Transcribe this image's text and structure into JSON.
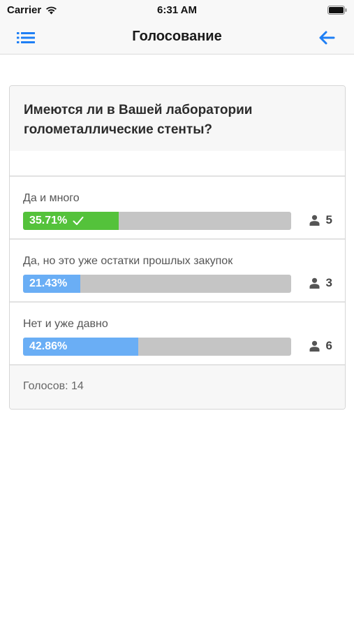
{
  "status_bar": {
    "carrier": "Carrier",
    "time": "6:31 AM"
  },
  "nav": {
    "title": "Голосование",
    "menu_icon": "list-icon",
    "back_icon": "arrow-left-icon",
    "accent_color": "#1e7ff5"
  },
  "poll": {
    "question": "Имеются ли в Вашей лаборатории голометаллические стенты?",
    "options": [
      {
        "label": "Да и много",
        "percent_text": "35.71%",
        "fraction": 0.3571,
        "votes": "5",
        "selected": true,
        "color": "#54c23b"
      },
      {
        "label": "Да, но это уже остатки прошлых закупок",
        "percent_text": "21.43%",
        "fraction": 0.2143,
        "votes": "3",
        "selected": false,
        "color": "#6aaef5"
      },
      {
        "label": "Нет и уже давно",
        "percent_text": "42.86%",
        "fraction": 0.4286,
        "votes": "6",
        "selected": false,
        "color": "#6aaef5"
      }
    ],
    "total_votes": "Голосов: 14"
  }
}
